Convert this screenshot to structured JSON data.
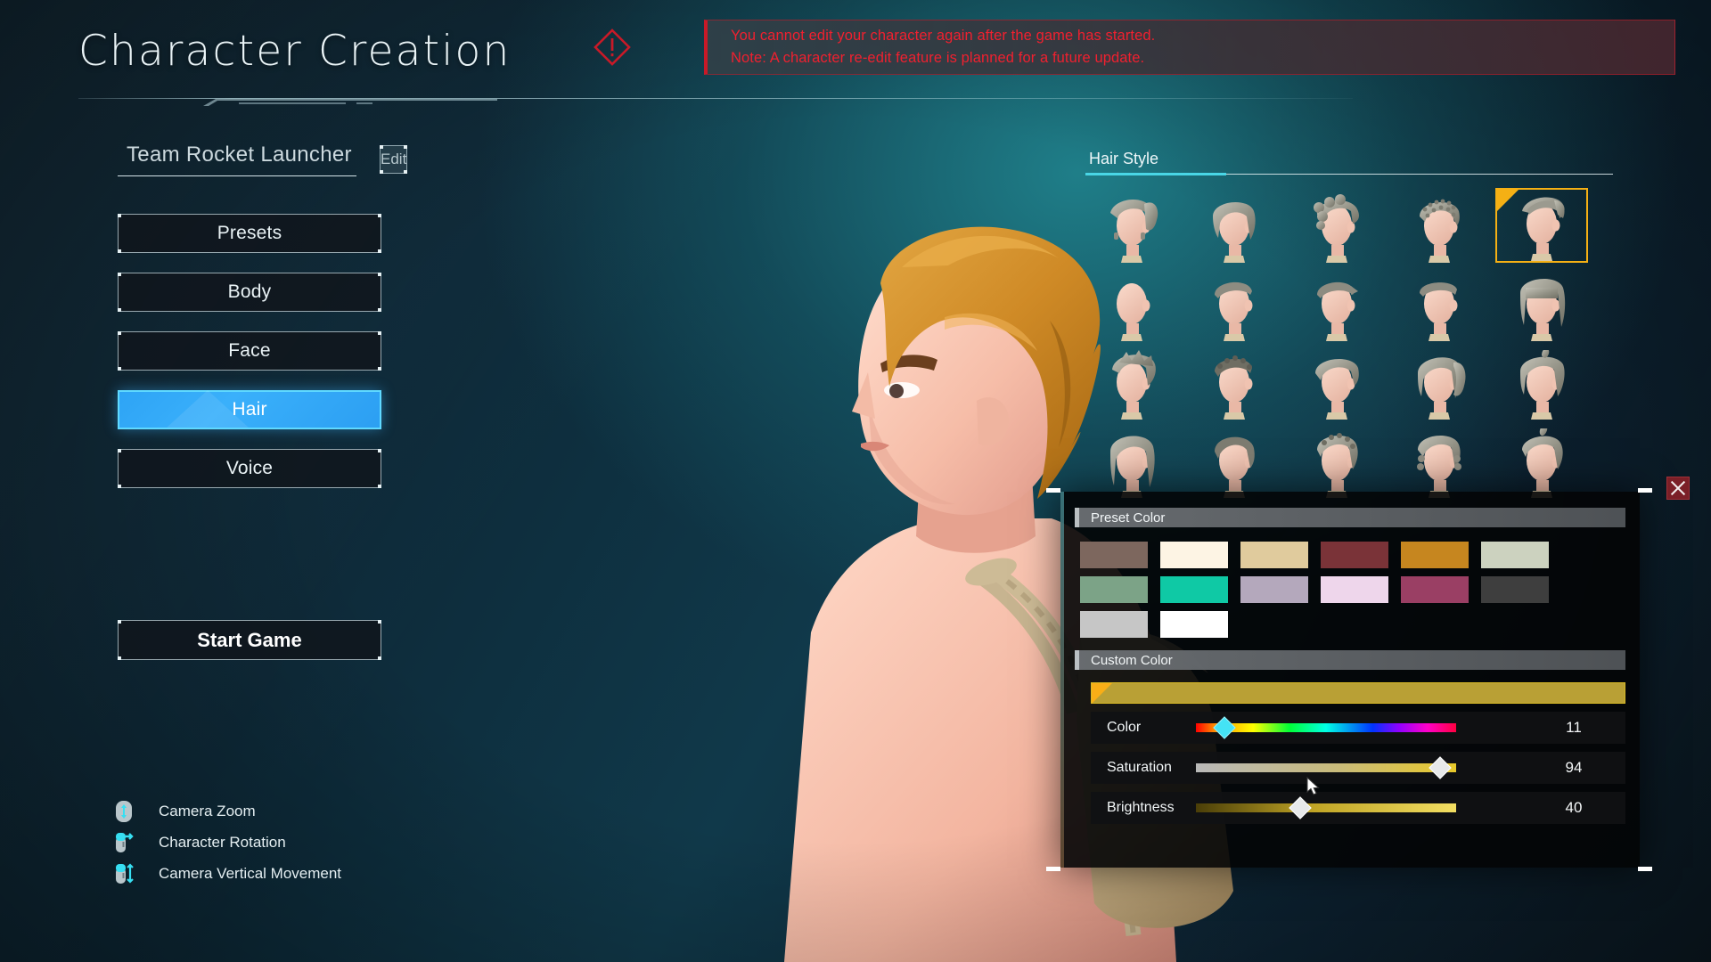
{
  "page_title": "Character Creation",
  "warning": {
    "icon": "warning-diamond-icon",
    "line1": "You cannot edit your character again after the game has started.",
    "line2": "Note: A character re-edit feature is planned for a future update.",
    "text_color": "#f0202f",
    "accent_color": "#c81a28"
  },
  "character": {
    "name": "Team Rocket Launcher",
    "edit_label": "Edit"
  },
  "menu": {
    "items": [
      {
        "label": "Presets",
        "active": false
      },
      {
        "label": "Body",
        "active": false
      },
      {
        "label": "Face",
        "active": false
      },
      {
        "label": "Hair",
        "active": true
      },
      {
        "label": "Voice",
        "active": false
      }
    ],
    "start_label": "Start Game",
    "active_color": "#2ea4f5",
    "active_border": "#5fd9ff"
  },
  "hints": [
    {
      "icon": "mouse-scroll-icon",
      "label": "Camera Zoom"
    },
    {
      "icon": "mouse-drag-horizontal-icon",
      "label": "Character Rotation"
    },
    {
      "icon": "mouse-drag-vertical-icon",
      "label": "Camera Vertical Movement"
    }
  ],
  "hair_panel": {
    "tab_label": "Hair Style",
    "tab_underline_color": "#49d6e6",
    "selected_index": 4,
    "selection_color": "#f5b014",
    "thumbnails": [
      {
        "name": "hair-style-1",
        "style": "ponytail-braids"
      },
      {
        "name": "hair-style-2",
        "style": "short-bob"
      },
      {
        "name": "hair-style-3",
        "style": "thick-dreads"
      },
      {
        "name": "hair-style-4",
        "style": "cornrows"
      },
      {
        "name": "hair-style-5",
        "style": "swept-undercut"
      },
      {
        "name": "hair-style-6",
        "style": "bald"
      },
      {
        "name": "hair-style-7",
        "style": "buzz-cut"
      },
      {
        "name": "hair-style-8",
        "style": "buzz-fade"
      },
      {
        "name": "hair-style-9",
        "style": "flat-top"
      },
      {
        "name": "hair-style-10",
        "style": "straight-bangs"
      },
      {
        "name": "hair-style-11",
        "style": "spiky-swept"
      },
      {
        "name": "hair-style-12",
        "style": "tight-curls"
      },
      {
        "name": "hair-style-13",
        "style": "bowl-cut"
      },
      {
        "name": "hair-style-14",
        "style": "side-ponytail"
      },
      {
        "name": "hair-style-15",
        "style": "ahoge-medium"
      },
      {
        "name": "hair-style-16",
        "style": "parted-long"
      },
      {
        "name": "hair-style-17",
        "style": "helmet-cut"
      },
      {
        "name": "hair-style-18",
        "style": "braided-crown"
      },
      {
        "name": "hair-style-19",
        "style": "twin-braids"
      },
      {
        "name": "hair-style-20",
        "style": "ahoge-short"
      }
    ]
  },
  "color_picker": {
    "close_icon": "close-x-icon",
    "preset_section_label": "Preset Color",
    "custom_section_label": "Custom Color",
    "preset_colors": [
      "#7d675e",
      "#fdf4e4",
      "#e0cb9d",
      "#7a3338",
      "#c6861f",
      "#ccd2bf",
      "#7ca387",
      "#0fc9a5",
      "#b4a8bc",
      "#eed6eb",
      "#9a3f64",
      "#3e3e3e",
      "#c6c6c6",
      "#ffffff"
    ],
    "preview_color": "#b9a035",
    "sliders": [
      {
        "label": "Color",
        "value": 11,
        "percent": 11,
        "track": "hue",
        "knob": "cyan"
      },
      {
        "label": "Saturation",
        "value": 94,
        "percent": 94,
        "track": "sat",
        "knob": "white"
      },
      {
        "label": "Brightness",
        "value": 40,
        "percent": 40,
        "track": "bri",
        "knob": "white"
      }
    ]
  }
}
